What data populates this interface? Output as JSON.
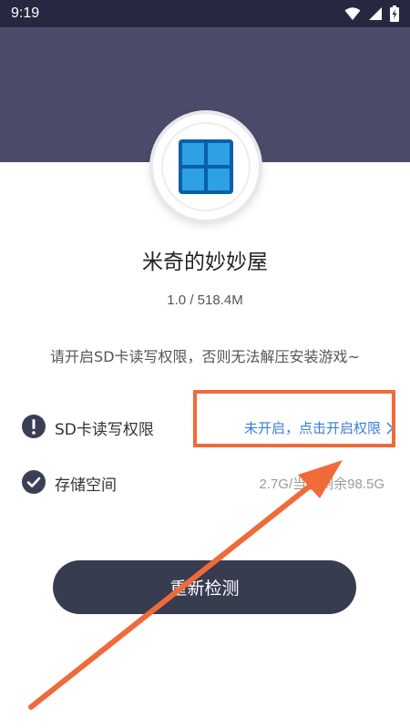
{
  "status_bar": {
    "time": "9:19"
  },
  "app": {
    "name": "米奇的妙妙屋",
    "version_size": "1.0 / 518.4M"
  },
  "prompt": "请开启SD卡读写权限，否则无法解压安装游戏~",
  "permissions": {
    "sd": {
      "label": "SD卡读写权限",
      "status": "未开启，点击开启权限"
    },
    "storage": {
      "label": "存储空间",
      "value": "2.7G/当前剩余98.5G"
    }
  },
  "recheck_button": "重新检测",
  "colors": {
    "header": "#4b4b6a",
    "accent_link": "#3a7ed8",
    "highlight": "#f06a3a",
    "button": "#373c4f"
  }
}
